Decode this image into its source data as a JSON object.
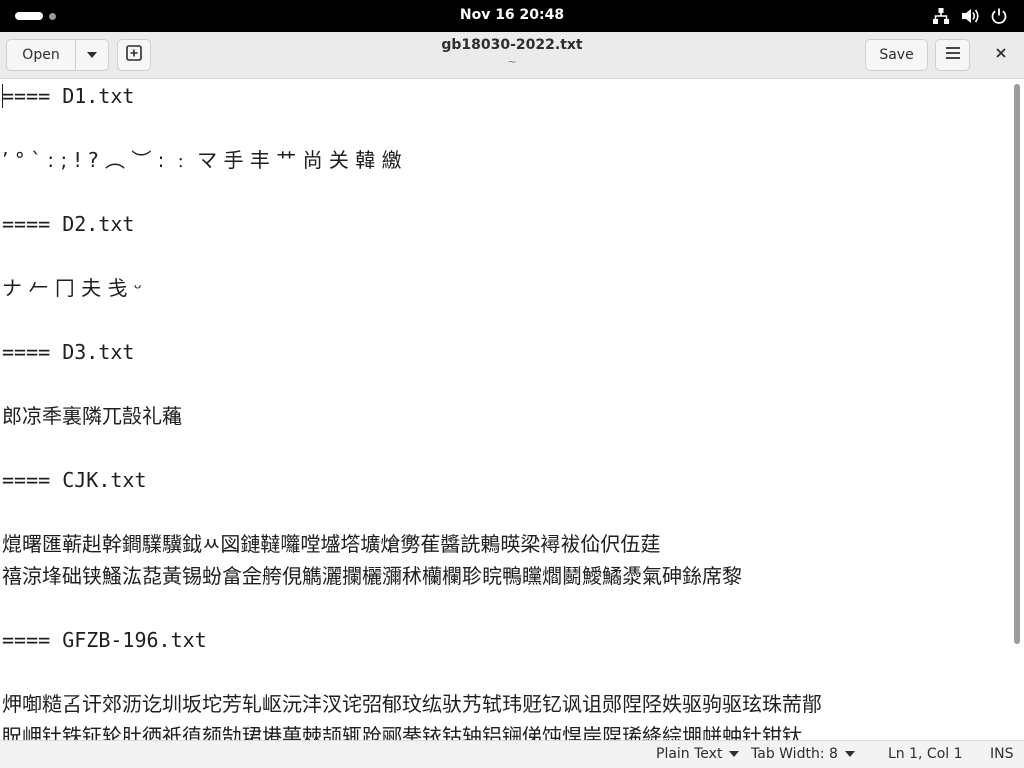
{
  "topbar": {
    "clock": "Nov 16  20:48",
    "icons": [
      "network-icon",
      "volume-icon",
      "power-icon"
    ]
  },
  "headerbar": {
    "open_label": "Open",
    "title": "gb18030-2022.txt",
    "subtitle": "~",
    "save_label": "Save",
    "icons": [
      "chevron-down-icon",
      "new-tab-icon",
      "hamburger-menu-icon",
      "close-icon"
    ]
  },
  "document": {
    "lines": [
      "==== D1.txt",
      "",
      " ’ ° ` : ; ! ? ︵ ︶ : ﹕ マ 手 丰 艹 尚 关 韓 繳",
      "",
      "==== D2.txt",
      "",
      "ナ 𠂉 冂 夫 戋 ᵕ",
      "",
      "==== D3.txt",
      "",
      "郎凉秊裏隣兀嗀礼蘒",
      "",
      "==== CJK.txt",
      "",
      "熴曙匯蕲赳幹鐧驜驥鉞ㅆ図鏈韃囖嘡墭㙮壙熗勶萑醬詵鶇暎梁襑袚佡伬伍莛",
      "禧涼埄础铗鰠汯莻黃锡蚡畣佱舿俔觹灑攔欐瀰秫欗欄聄睆鴨矘爓鬭鱫鱊㵗氣砷銯席黎",
      "",
      "==== GFZB-196.txt",
      "",
      "炠啣糙叾讦郊沥讫圳坂坨芳轧岖沅沣汊诧弨郁玟纮驮艿轼玮觃钇讽诅郧陧陉妷驱驹驱玹珠荋鄁",
      "眖岬钍铁钲轮肚徆祇徝颏勂珺塂菓棘颉辄跄郦拲铱钴轴铝锎俤饨悍岸陧琋絳綜堋帡蚛钍钳钛"
    ]
  },
  "statusbar": {
    "language": "Plain Text",
    "tab_width": "Tab Width: 8",
    "position": "Ln 1, Col 1",
    "mode": "INS"
  }
}
